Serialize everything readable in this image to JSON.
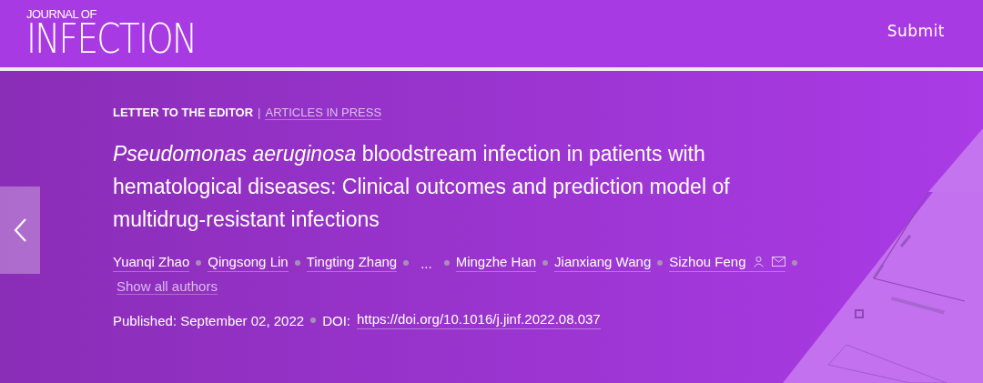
{
  "header": {
    "logo_small": "JOURNAL OF",
    "logo_large": "INFECTION",
    "submit": "Submit"
  },
  "article": {
    "category": "LETTER TO THE EDITOR",
    "separator": "|",
    "section": "ARTICLES IN PRESS",
    "title": "*Pseudomonas aeruginosa* bloodstream infection in patients with hematological diseases: Clinical outcomes and prediction model of multidrug-resistant infections",
    "authors": [
      {
        "kind": "author",
        "name": "Yuanqi Zhao",
        "corresponding": false
      },
      {
        "kind": "author",
        "name": "Qingsong Lin",
        "corresponding": false
      },
      {
        "kind": "author",
        "name": "Tingting Zhang",
        "corresponding": false
      },
      {
        "kind": "ellipsis",
        "name": "..."
      },
      {
        "kind": "author",
        "name": "Mingzhe Han",
        "corresponding": false
      },
      {
        "kind": "author",
        "name": "Jianxiang Wang",
        "corresponding": false
      },
      {
        "kind": "author",
        "name": "Sizhou Feng",
        "corresponding": true
      }
    ],
    "show_all": "Show all authors",
    "published": "Published: September 02, 2022",
    "doi_label": "DOI:",
    "doi": "https://doi.org/10.1016/j.jinf.2022.08.037"
  }
}
